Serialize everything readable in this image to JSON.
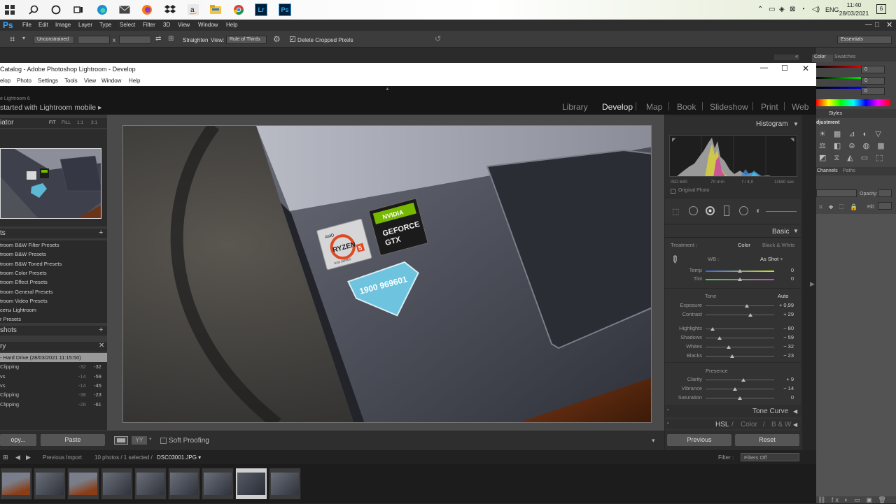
{
  "taskbar": {
    "icons": [
      "windows-icon",
      "search-icon",
      "cortana-icon",
      "task-view-icon",
      "edge-icon",
      "mail-icon",
      "firefox-icon",
      "dropbox-icon",
      "amazon-icon",
      "file-explorer-icon",
      "chrome-icon",
      "lightroom-icon",
      "photoshop-icon"
    ],
    "lr_label": "Lr",
    "ps_label": "Ps",
    "lang": "ENG",
    "time": "11:40",
    "date": "28/03/2021",
    "notif_count": "6"
  },
  "photoshop": {
    "logo": "Ps",
    "menu": [
      "File",
      "Edit",
      "Image",
      "Layer",
      "Type",
      "Select",
      "Filter",
      "3D",
      "View",
      "Window",
      "Help"
    ],
    "options": {
      "ratio": "Unconstrained",
      "x": "x",
      "straighten": "Straighten",
      "view_label": "View:",
      "view_value": "Rule of Thirds",
      "delete_cropped": "Delete Cropped Pixels",
      "workspace": "Essentials"
    },
    "dock": {
      "color_tab": "Color",
      "swatches_tab": "Swatches",
      "rgb": [
        "0",
        "0",
        "0"
      ],
      "styles_tab": "Styles",
      "adjustments": "djustment",
      "channels_tab": "Channels",
      "paths_tab": "Paths",
      "opacity": "Opacity:",
      "fill": "Fill:"
    }
  },
  "lightroom": {
    "title": "Catalog - Adobe Photoshop Lightroom - Develop",
    "menu": [
      "elop",
      "Photo",
      "Settings",
      "Tools",
      "View",
      "Window",
      "Help"
    ],
    "identity_small": "e Lightroom 6",
    "identity_main": "started with Lightroom mobile",
    "modules": [
      "Library",
      "Develop",
      "Map",
      "Book",
      "Slideshow",
      "Print",
      "Web"
    ],
    "navigator": {
      "label": "iator",
      "fit": "FIT",
      "fill": "FILL",
      "one": "1:1",
      "three": "3:1"
    },
    "presets_label": "ts",
    "presets": [
      "troom B&W Filter Presets",
      "troom B&W Presets",
      "troom B&W Toned Presets",
      "troom Color Presets",
      "troom Effect Presets",
      "troom General Presets",
      "troom Video Presets",
      "сеты Lightroom",
      "r Presets"
    ],
    "snapshots_label": "shots",
    "history_label": "ry",
    "history": [
      {
        "name": "- Hard Drive (28/03/2021 11:15:50)",
        "a": "",
        "b": ""
      },
      {
        "name": "Clipping",
        "a": "-32",
        "b": "-32"
      },
      {
        "name": "vs",
        "a": "-14",
        "b": "-59"
      },
      {
        "name": "vs",
        "a": "-14",
        "b": "-45"
      },
      {
        "name": "Clipping",
        "a": "-38",
        "b": "-23"
      },
      {
        "name": "Clipping",
        "a": "-26",
        "b": "-61"
      }
    ],
    "copy_btn": "opy...",
    "paste_btn": "Paste",
    "soft_proofing": "Soft Proofing",
    "histogram": {
      "label": "Histogram",
      "iso": "ISO 640",
      "focal": "70 mm",
      "aperture": "f / 4,0",
      "shutter": "1/160 sec",
      "original": "Original Photo"
    },
    "basic": {
      "label": "Basic",
      "treatment": "Treatment :",
      "color": "Color",
      "bw": "Black & White",
      "wb": "WB :",
      "wb_value": "As Shot",
      "tone": "Tone",
      "auto": "Auto",
      "presence": "Presence"
    },
    "sliders": [
      {
        "label": "Temp",
        "value": "0",
        "pos": 0.5
      },
      {
        "label": "Tint",
        "value": "0",
        "pos": 0.5
      },
      {
        "label": "Exposure",
        "value": "+ 0,99",
        "pos": 0.6
      },
      {
        "label": "Contrast",
        "value": "+ 29",
        "pos": 0.65
      },
      {
        "label": "Highlights",
        "value": "− 80",
        "pos": 0.1
      },
      {
        "label": "Shadows",
        "value": "− 59",
        "pos": 0.2
      },
      {
        "label": "Whites",
        "value": "− 32",
        "pos": 0.34
      },
      {
        "label": "Blacks",
        "value": "− 23",
        "pos": 0.39
      },
      {
        "label": "Clarity",
        "value": "+ 9",
        "pos": 0.55
      },
      {
        "label": "Vibrance",
        "value": "− 14",
        "pos": 0.43
      },
      {
        "label": "Saturation",
        "value": "0",
        "pos": 0.5
      }
    ],
    "tone_curve": "Tone Curve",
    "hsl": "HSL",
    "hsl_color": "Color",
    "hsl_bw": "B & W",
    "previous_btn": "Previous",
    "reset_btn": "Reset",
    "filmstrip": {
      "previous_import": "Previous Import",
      "count": "10 photos / 1 selected /",
      "file": "DSC03001.JPG",
      "filter_label": "Filter :",
      "filter_value": "Filters Off"
    },
    "stickers": {
      "amd": "AMD",
      "ryzen": "RYZEN",
      "series": "5000 SERIES",
      "ryzen_num": "5",
      "nvidia": "NVIDIA",
      "geforce": "GEFORCE",
      "gtx": "GTX",
      "phone": "1900 969601"
    }
  }
}
